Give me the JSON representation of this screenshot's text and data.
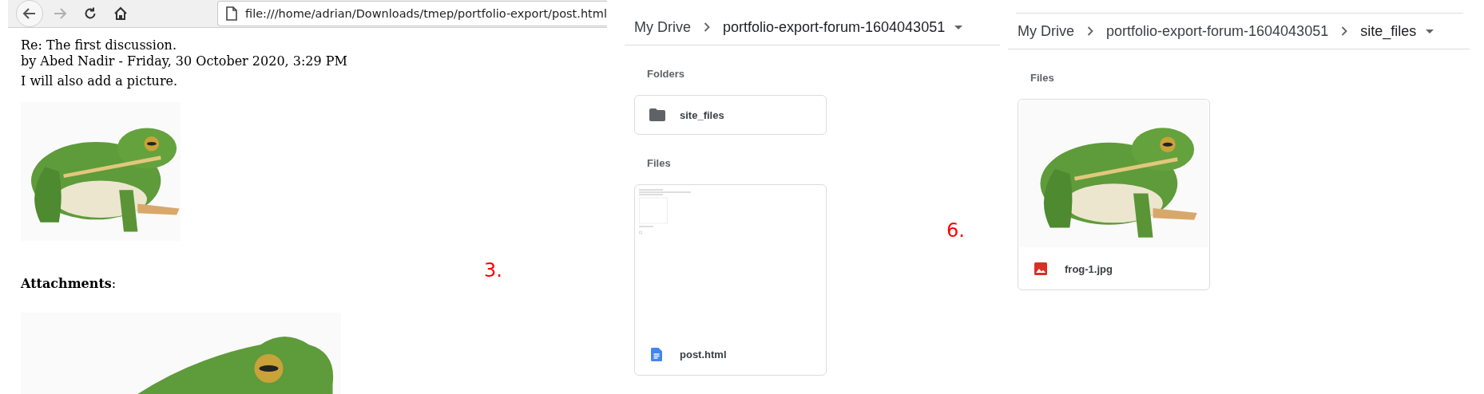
{
  "browser": {
    "back": {
      "disabled": false
    },
    "forward": {
      "disabled": true
    },
    "url": "file:///home/adrian/Downloads/tmep/portfolio-export/post.html",
    "post": {
      "subject": "Re: The first discussion.",
      "byline": "by Abed Nadir - Friday, 30 October 2020, 3:29 PM",
      "message": "I will also add a picture.",
      "attachments": "**Attachments**:"
    },
    "step": "3."
  },
  "drive_views": [
    {
      "breadcrumbs": [
        "My Drive",
        "portfolio-export-forum-1604043051"
      ],
      "top_rule": false,
      "sections": [
        {
          "title": "Folders",
          "items": [
            {
              "kind": "folder",
              "name": "site_files"
            }
          ]
        },
        {
          "title": "Files",
          "items": [
            {
              "kind": "document",
              "name": "post.html"
            }
          ]
        }
      ],
      "step": "6."
    },
    {
      "breadcrumbs": [
        "My Drive",
        "portfolio-export-forum-1604043051",
        "site_files"
      ],
      "top_rule": true,
      "sections": [
        {
          "title": "Files",
          "items": [
            {
              "kind": "image",
              "name": "frog-1.jpg"
            }
          ]
        }
      ]
    }
  ]
}
